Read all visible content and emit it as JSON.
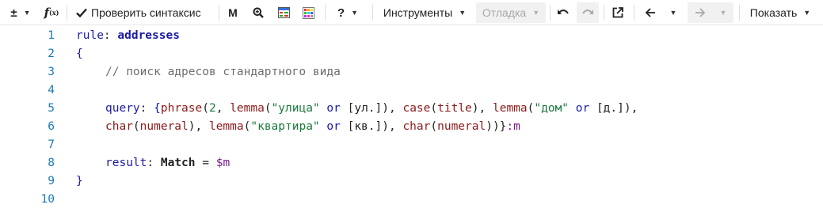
{
  "toolbar": {
    "plus_minus_icon": "±",
    "fx_icon": "f(x)",
    "check_syntax_label": "Проверить синтаксис",
    "m_label": "M",
    "help_label": "?",
    "tools_label": "Инструменты",
    "debug_label": "Отладка",
    "show_label": "Показать",
    "icons": [
      "plus-minus-icon",
      "function-icon",
      "checkmark-icon",
      "search-zoom-icon",
      "grid-color-icon",
      "palette-icon",
      "help-icon",
      "undo-icon",
      "redo-icon",
      "external-link-icon",
      "arrow-left-icon",
      "arrow-right-icon"
    ]
  },
  "editor": {
    "line_numbers": [
      "1",
      "2",
      "3",
      "4",
      "5",
      "6",
      "7",
      "8",
      "9",
      "10"
    ],
    "tokens": {
      "l1_rule": "rule",
      "l1_colon": ": ",
      "l1_name": "addresses",
      "l2_brace": "{",
      "l3_comment": "// поиск адресов стандартного вида",
      "l5_query": "query",
      "l5_colon": ": ",
      "l5_ob": "{",
      "l5_phrase": "phrase",
      "l5_p1": "(",
      "l5_num": "2",
      "l5_c1": ", ",
      "l5_lemma1": "lemma",
      "l5_p2": "(",
      "l5_str1": "\"улица\"",
      "l5_or1": " or ",
      "l5_b1": "[ул.]",
      "l5_p3": "), ",
      "l5_case": "case",
      "l5_p4": "(",
      "l5_title": "title",
      "l5_p5": "), ",
      "l5_lemma2": "lemma",
      "l5_p6": "(",
      "l5_str2": "\"дом\"",
      "l5_or2": " or ",
      "l5_b2": "[д.]",
      "l5_p7": "),",
      "l6_char1": "char",
      "l6_p1": "(",
      "l6_numeral1": "numeral",
      "l6_p2": "), ",
      "l6_lemma": "lemma",
      "l6_p3": "(",
      "l6_str": "\"квартира\"",
      "l6_or": " or ",
      "l6_b": "[кв.]",
      "l6_p4": "), ",
      "l6_char2": "char",
      "l6_p5": "(",
      "l6_numeral2": "numeral",
      "l6_p6": "))}",
      "l6_m": ":m",
      "l8_result": "result",
      "l8_colon": ": ",
      "l8_match": "Match",
      "l8_eq": " = ",
      "l8_var": "$m",
      "l9_brace": "}"
    }
  }
}
